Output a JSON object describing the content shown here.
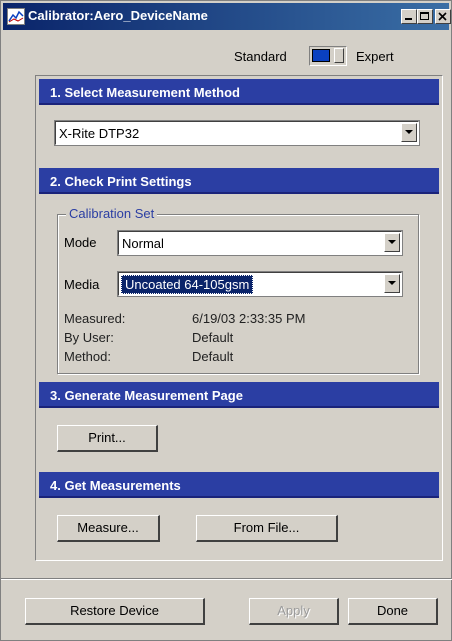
{
  "window": {
    "title": "Calibrator:Aero_DeviceName",
    "icons": [
      "app-icon",
      "minimize-icon",
      "maximize-icon",
      "close-icon"
    ]
  },
  "mode_toggle": {
    "left_label": "Standard",
    "right_label": "Expert",
    "thumb_color": "#0a40c0"
  },
  "sections": {
    "s1": {
      "title": "1. Select Measurement Method"
    },
    "s2": {
      "title": "2. Check Print Settings"
    },
    "s3": {
      "title": "3. Generate Measurement Page"
    },
    "s4": {
      "title": "4. Get Measurements"
    }
  },
  "measurement_method": {
    "selected": "X-Rite DTP32"
  },
  "calibration_set": {
    "title": "Calibration Set",
    "mode_label": "Mode",
    "mode_value": "Normal",
    "media_label": "Media",
    "media_value": "Uncoated 64-105gsm",
    "info": [
      {
        "label": "Measured:",
        "value": "6/19/03 2:33:35 PM"
      },
      {
        "label": "By User:",
        "value": "Default"
      },
      {
        "label": "Method:",
        "value": "Default"
      }
    ]
  },
  "buttons": {
    "print": "Print...",
    "measure": "Measure...",
    "from_file": "From File...",
    "restore_device": "Restore Device",
    "apply": "Apply",
    "done": "Done"
  },
  "colors": {
    "section_header": "#2b3ea3",
    "title_bar": "#0a246a",
    "selection": "#0a246a"
  }
}
